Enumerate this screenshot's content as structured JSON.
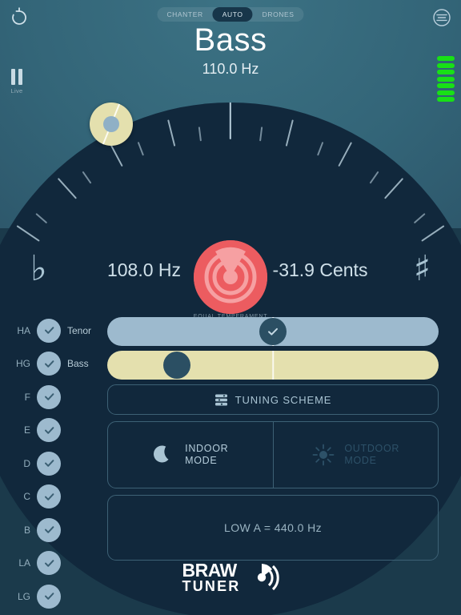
{
  "app": {
    "name": "Braw Tuner",
    "logo_line1": "BRAW",
    "logo_line2": "TUNER"
  },
  "header": {
    "reset_icon": "rotate-ccw-icon",
    "menu_icon": "hamburger-circle-icon",
    "segments": [
      {
        "label": "CHANTER",
        "active": false
      },
      {
        "label": "AUTO",
        "active": true
      },
      {
        "label": "DRONES",
        "active": false
      }
    ],
    "title": "Bass",
    "frequency": "110.0 Hz",
    "pause_icon": "pause-icon",
    "live_label": "Live",
    "meter_segments": 7,
    "meter_color": "#18e016"
  },
  "readout": {
    "flat_symbol": "♭",
    "sharp_symbol": "♯",
    "detected_hz": "108.0 Hz",
    "cents": "-31.9 Cents",
    "temperament": "EQUAL TEMPERAMENT",
    "target_color": "#ec5c60"
  },
  "dial": {
    "tick_count": 17,
    "needle_position_deg": -62,
    "puck_color": "#e4e0ae"
  },
  "notes": [
    {
      "name": "HA",
      "sub": "Tenor",
      "checked": true
    },
    {
      "name": "HG",
      "sub": "Bass",
      "checked": true
    },
    {
      "name": "F",
      "sub": "",
      "checked": true
    },
    {
      "name": "E",
      "sub": "",
      "checked": true
    },
    {
      "name": "D",
      "sub": "",
      "checked": true
    },
    {
      "name": "C",
      "sub": "",
      "checked": true
    },
    {
      "name": "B",
      "sub": "",
      "checked": true
    },
    {
      "name": "LA",
      "sub": "",
      "checked": true
    },
    {
      "name": "LG",
      "sub": "",
      "checked": true
    }
  ],
  "sliders": [
    {
      "id": "tenor",
      "label": "Tenor",
      "value_pct": 50,
      "color": "#9dbace",
      "knob": "check"
    },
    {
      "id": "bass",
      "label": "Bass",
      "value_pct": 21,
      "color": "#e4e0ae",
      "knob": "plain"
    }
  ],
  "controls": {
    "tuning_scheme_label": "TUNING SCHEME",
    "tuning_scheme_icon": "sliders-icon",
    "indoor": {
      "line1": "INDOOR",
      "line2": "MODE",
      "icon": "moon-icon",
      "active": true
    },
    "outdoor": {
      "line1": "OUTDOOR",
      "line2": "MODE",
      "icon": "sun-icon",
      "active": false
    },
    "low_a_label": "LOW A = 440.0 Hz"
  }
}
